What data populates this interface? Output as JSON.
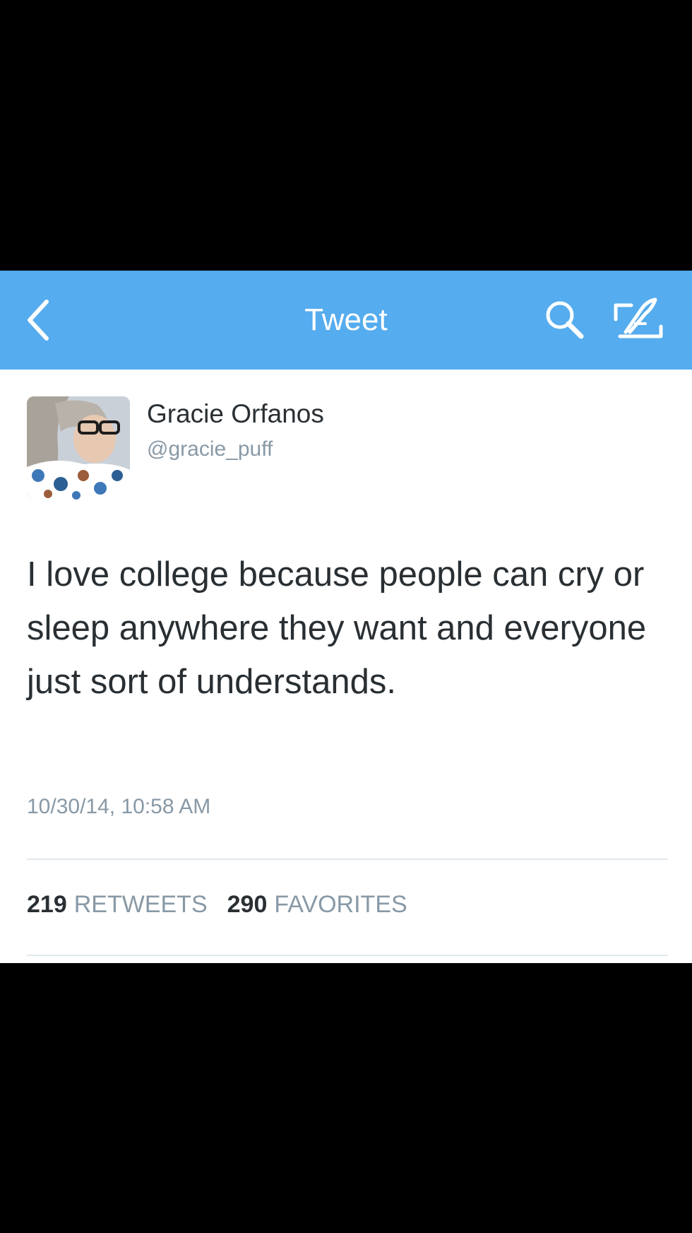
{
  "navbar": {
    "title": "Tweet",
    "back_icon": "chevron-left-icon",
    "search_icon": "search-icon",
    "compose_icon": "compose-icon",
    "background_color": "#55acee"
  },
  "tweet": {
    "author": {
      "display_name": "Gracie Orfanos",
      "screen_name": "@gracie_puff"
    },
    "text": "I love college because people can cry or sleep anywhere they want and everyone just sort of understands.",
    "timestamp": "10/30/14, 10:58 AM",
    "stats": {
      "retweets_count": "219",
      "retweets_label": "RETWEETS",
      "favorites_count": "290",
      "favorites_label": "FAVORITES"
    }
  }
}
